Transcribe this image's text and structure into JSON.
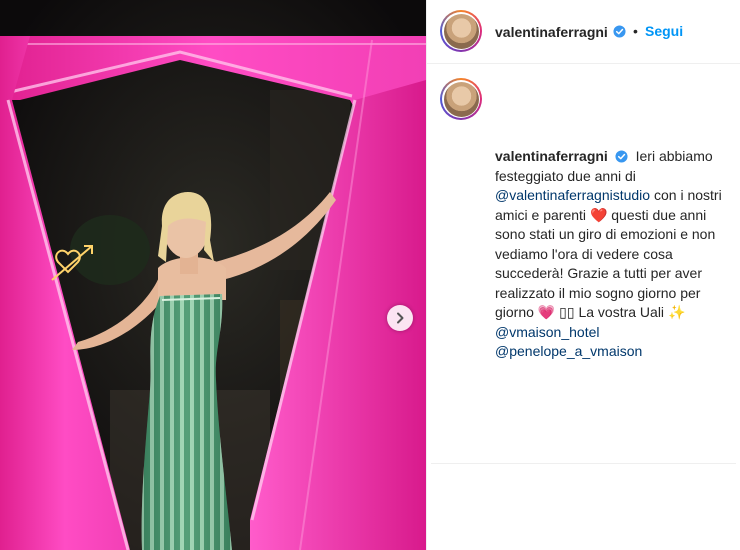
{
  "post": {
    "author": {
      "username": "valentinaferragni",
      "verified": true
    },
    "follow_label": "Segui",
    "separator": "•",
    "caption": {
      "text_1": "Ieri abbiamo festeggiato due anni di",
      "mention_1": "@valentinaferragnistudio",
      "text_2": "con i nostri amici e parenti",
      "emoji_heart": "❤️",
      "text_3": "questi due anni sono stati un giro di emozioni e non vediamo l'ora di vedere cosa succederà! Grazie a tutti per aver realizzato il mio sogno giorno per giorno",
      "emoji_pink_heart": "💗",
      "emoji_unknown": "▯▯",
      "text_4": "La vostra Uali",
      "emoji_sparkles": "✨",
      "mention_2": "@vmaison_hotel",
      "mention_3": "@penelope_a_vmaison"
    }
  },
  "icons": {
    "verified": "verified-badge-icon",
    "next": "chevron-right-icon",
    "neon": "heart-arrow-neon-sign"
  },
  "colors": {
    "accent_blue": "#0095f6",
    "mention": "#00376b",
    "verified_blue": "#3897f0",
    "neon_pink": "#ff3fbf"
  }
}
